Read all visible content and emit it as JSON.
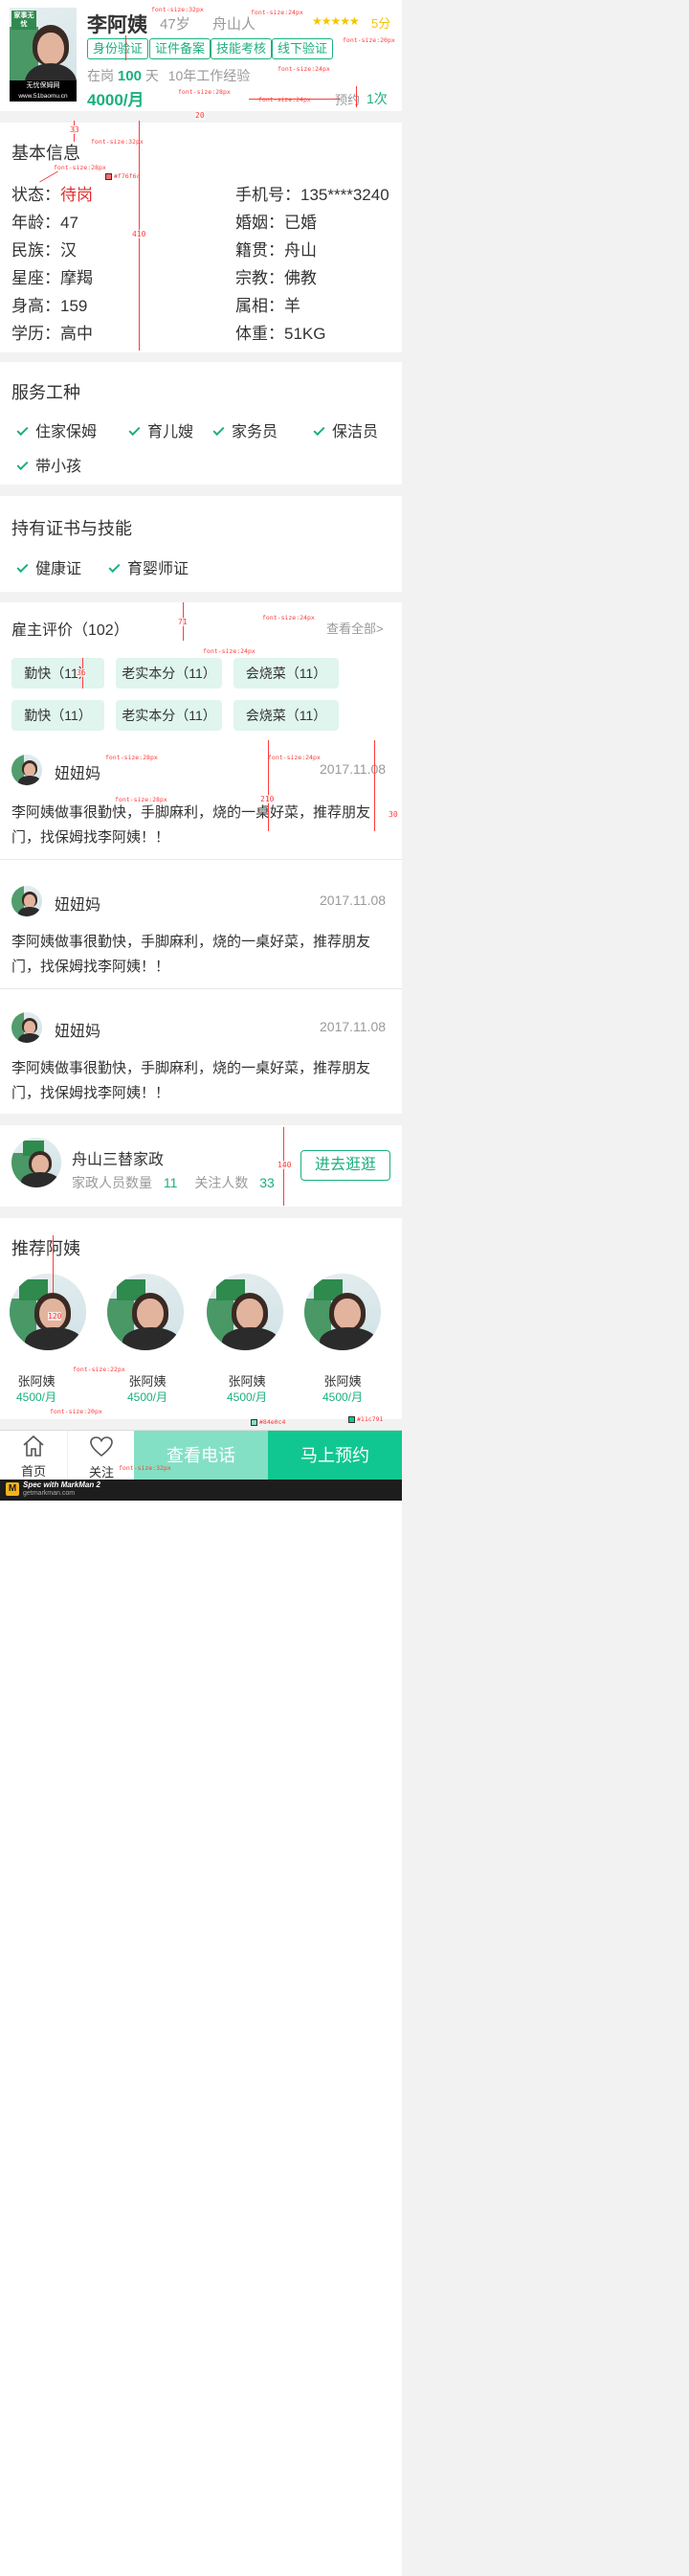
{
  "profile": {
    "name": "李阿姨",
    "age": "47岁",
    "hometown": "舟山人",
    "stars": "★★★★★",
    "score": "5分",
    "tags": [
      "身份验证",
      "证件备案",
      "技能考核",
      "线下验证"
    ],
    "status_prefix": "在岗",
    "days": "100",
    "days_unit": "天",
    "experience": "10年工作经验",
    "salary": "4000/月",
    "booked_label": "预约",
    "booked_count": "1次",
    "photo_logo": "家事无忧",
    "photo_brand": "无忧保姆网",
    "photo_url": "www.51baomu.cn"
  },
  "basic": {
    "title": "基本信息",
    "left": [
      {
        "k": "状态：",
        "v": "待岗"
      },
      {
        "k": "年龄：",
        "v": "47"
      },
      {
        "k": "民族：",
        "v": "汉"
      },
      {
        "k": "星座：",
        "v": "摩羯"
      },
      {
        "k": "身高：",
        "v": "159"
      },
      {
        "k": "学历：",
        "v": "高中"
      }
    ],
    "right": [
      {
        "k": "手机号：",
        "v": "135****3240"
      },
      {
        "k": "婚姻：",
        "v": "已婚"
      },
      {
        "k": "籍贯：",
        "v": "舟山"
      },
      {
        "k": "宗教：",
        "v": "佛教"
      },
      {
        "k": "属相：",
        "v": "羊"
      },
      {
        "k": "体重：",
        "v": "51KG"
      }
    ]
  },
  "services": {
    "title": "服务工种",
    "items": [
      "住家保姆",
      "育儿嫂",
      "家务员",
      "保洁员",
      "带小孩"
    ]
  },
  "certs": {
    "title": "持有证书与技能",
    "items": [
      "健康证",
      "育婴师证"
    ]
  },
  "reviews": {
    "title": "雇主评价（102）",
    "view_all": "查看全部>",
    "chips": [
      "勤快（11）",
      "老实本分（11）",
      "会烧菜（11）",
      "勤快（11）",
      "老实本分（11）",
      "会烧菜（11）"
    ],
    "items": [
      {
        "user": "妞妞妈",
        "date": "2017.11.08",
        "text": "李阿姨做事很勤快，手脚麻利，烧的一桌好菜，推荐朋友门，找保姆找李阿姨！！"
      },
      {
        "user": "妞妞妈",
        "date": "2017.11.08",
        "text": "李阿姨做事很勤快，手脚麻利，烧的一桌好菜，推荐朋友门，找保姆找李阿姨！！"
      },
      {
        "user": "妞妞妈",
        "date": "2017.11.08",
        "text": "李阿姨做事很勤快，手脚麻利，烧的一桌好菜，推荐朋友门，找保姆找李阿姨！！"
      }
    ]
  },
  "agency": {
    "name": "舟山三替家政",
    "staff_label": "家政人员数量",
    "staff_count": "11",
    "follow_label": "关注人数",
    "follow_count": "33",
    "enter_label": "进去逛逛"
  },
  "recommend": {
    "title": "推荐阿姨",
    "items": [
      {
        "name": "张阿姨",
        "salary": "4500/月"
      },
      {
        "name": "张阿姨",
        "salary": "4500/月"
      },
      {
        "name": "张阿姨",
        "salary": "4500/月"
      },
      {
        "name": "张阿姨",
        "salary": "4500/月"
      }
    ]
  },
  "bottom_bar": {
    "home": "首页",
    "follow": "关注",
    "call": "查看电话",
    "book": "马上预约"
  },
  "specs": {
    "f32": "font-size:32px",
    "f24": "font-size:24px",
    "f20": "font-size:20px",
    "f28": "font-size:28px",
    "f22": "font-size:22px",
    "c_red": "#f76f6c",
    "c_light": "#84e0c4",
    "c_green": "#11c791",
    "n20": "20",
    "n33": "33",
    "n410": "410",
    "n71": "71",
    "n36": "36",
    "n210": "210",
    "n30": "30",
    "n140": "140",
    "n120": "120",
    "markman": "Spec with MarkMan 2",
    "markman_url": "getmarkman.com"
  },
  "colors": {
    "accent": "#1ab07c",
    "status_red": "#e02e2e",
    "call_bg": "#84e0c4",
    "book_bg": "#11c791",
    "star": "#f5c400"
  }
}
